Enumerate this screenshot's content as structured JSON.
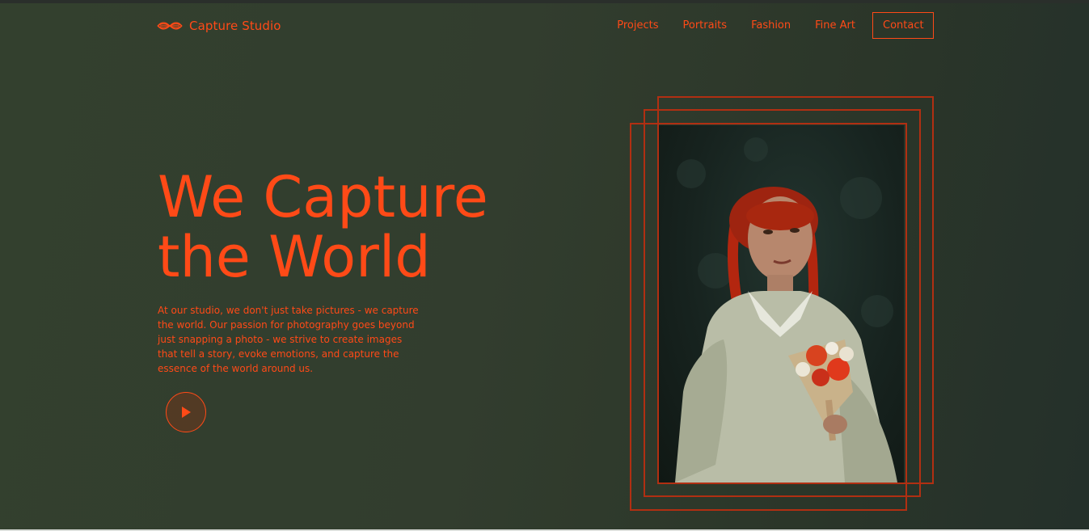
{
  "header": {
    "logo_text": "Capture Studio",
    "logo_icon": "wave-lines-icon",
    "nav": [
      {
        "label": "Projects"
      },
      {
        "label": "Portraits"
      },
      {
        "label": "Fashion"
      },
      {
        "label": "Fine Art"
      }
    ],
    "contact_label": "Contact"
  },
  "hero": {
    "title_line1": "We Capture",
    "title_line2": "the World",
    "description": "At our studio, we don't just take pictures - we capture the world. Our passion for photography goes beyond just snapping a photo - we strive to create images that tell a story, evoke emotions, and capture the essence of the world around us.",
    "play_icon": "play-icon"
  },
  "theme": {
    "accent": "#ff4a17",
    "frame": "#b12f12",
    "background": "#333f2e"
  }
}
